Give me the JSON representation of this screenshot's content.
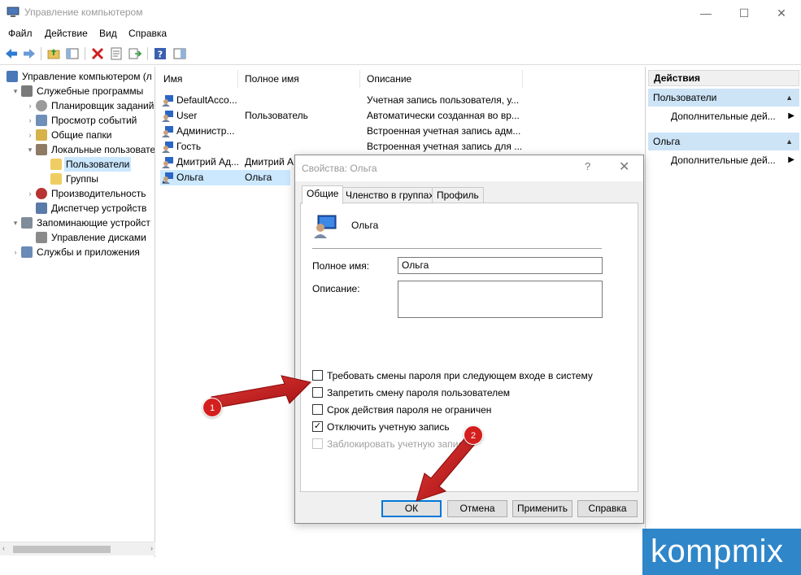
{
  "window": {
    "title": "Управление компьютером",
    "controls": {
      "minimize": "—",
      "maximize": "☐",
      "close": "✕"
    }
  },
  "menu": [
    "Файл",
    "Действие",
    "Вид",
    "Справка"
  ],
  "toolbar": {
    "icons": [
      "back-arrow-icon",
      "forward-arrow-icon",
      "up-folder-icon",
      "show-tree-icon",
      "delete-icon",
      "properties-icon",
      "export-icon",
      "help-icon",
      "show-action-pane-icon"
    ]
  },
  "tree": {
    "items": [
      {
        "label": "Управление компьютером (л",
        "level": 0,
        "expander": "",
        "icon": "computer-icon"
      },
      {
        "label": "Служебные программы",
        "level": 1,
        "expander": "▾",
        "icon": "tools-icon"
      },
      {
        "label": "Планировщик заданий",
        "level": 2,
        "expander": "›",
        "icon": "clock-icon"
      },
      {
        "label": "Просмотр событий",
        "level": 2,
        "expander": "›",
        "icon": "event-viewer-icon"
      },
      {
        "label": "Общие папки",
        "level": 2,
        "expander": "›",
        "icon": "shared-folder-icon"
      },
      {
        "label": "Локальные пользовате",
        "level": 2,
        "expander": "▾",
        "icon": "users-icon"
      },
      {
        "label": "Пользователи",
        "level": 3,
        "expander": "",
        "icon": "folder-icon",
        "selected": true
      },
      {
        "label": "Группы",
        "level": 3,
        "expander": "",
        "icon": "folder-icon"
      },
      {
        "label": "Производительность",
        "level": 2,
        "expander": "›",
        "icon": "performance-icon"
      },
      {
        "label": "Диспетчер устройств",
        "level": 2,
        "expander": "",
        "icon": "device-manager-icon"
      },
      {
        "label": "Запоминающие устройст",
        "level": 1,
        "expander": "▾",
        "icon": "storage-icon"
      },
      {
        "label": "Управление дисками",
        "level": 2,
        "expander": "",
        "icon": "disk-icon"
      },
      {
        "label": "Службы и приложения",
        "level": 1,
        "expander": "›",
        "icon": "services-icon"
      }
    ],
    "scroll_left": "‹",
    "scroll_right": "›"
  },
  "list": {
    "columns": [
      "Имя",
      "Полное имя",
      "Описание"
    ],
    "rows": [
      {
        "name": "DefaultAcco...",
        "fullname": "",
        "description": "Учетная запись пользователя, у..."
      },
      {
        "name": "User",
        "fullname": "Пользователь",
        "description": "Автоматически созданная во вр..."
      },
      {
        "name": "Администр...",
        "fullname": "",
        "description": "Встроенная учетная запись адм..."
      },
      {
        "name": "Гость",
        "fullname": "",
        "description": "Встроенная учетная запись для ..."
      },
      {
        "name": "Дмитрий Ад...",
        "fullname": "Дмитрий А",
        "description": ""
      },
      {
        "name": "Ольга",
        "fullname": "Ольга",
        "description": "",
        "selected": true
      }
    ]
  },
  "actions": {
    "header": "Действия",
    "sections": [
      {
        "title": "Пользователи",
        "item": "Дополнительные дей..."
      },
      {
        "title": "Ольга",
        "item": "Дополнительные дей..."
      }
    ]
  },
  "dialog": {
    "title": "Свойства: Ольга",
    "help": "?",
    "close": "✕",
    "tabs": [
      "Общие",
      "Членство в группах",
      "Профиль"
    ],
    "user_name": "Ольга",
    "fullname_label": "Полное имя:",
    "fullname_value": "Ольга",
    "description_label": "Описание:",
    "description_value": "",
    "checkboxes": [
      {
        "label": "Требовать смены пароля при следующем входе в систему",
        "checked": false,
        "enabled": true
      },
      {
        "label": "Запретить смену пароля пользователем",
        "checked": false,
        "enabled": true
      },
      {
        "label": "Срок действия пароля не ограничен",
        "checked": false,
        "enabled": true
      },
      {
        "label": "Отключить учетную запись",
        "checked": true,
        "enabled": true
      },
      {
        "label": "Заблокировать учетную запись",
        "checked": false,
        "enabled": false
      }
    ],
    "buttons": {
      "ok": "ОК",
      "cancel": "Отмена",
      "apply": "Применить",
      "help": "Справка"
    }
  },
  "annotations": {
    "step1": "1",
    "step2": "2"
  },
  "watermark": "kompmix",
  "colors": {
    "selection": "#cce8ff",
    "section_header": "#cde4f7",
    "annotation_red": "#d41f1f",
    "watermark_blue": "#2f86c9"
  }
}
